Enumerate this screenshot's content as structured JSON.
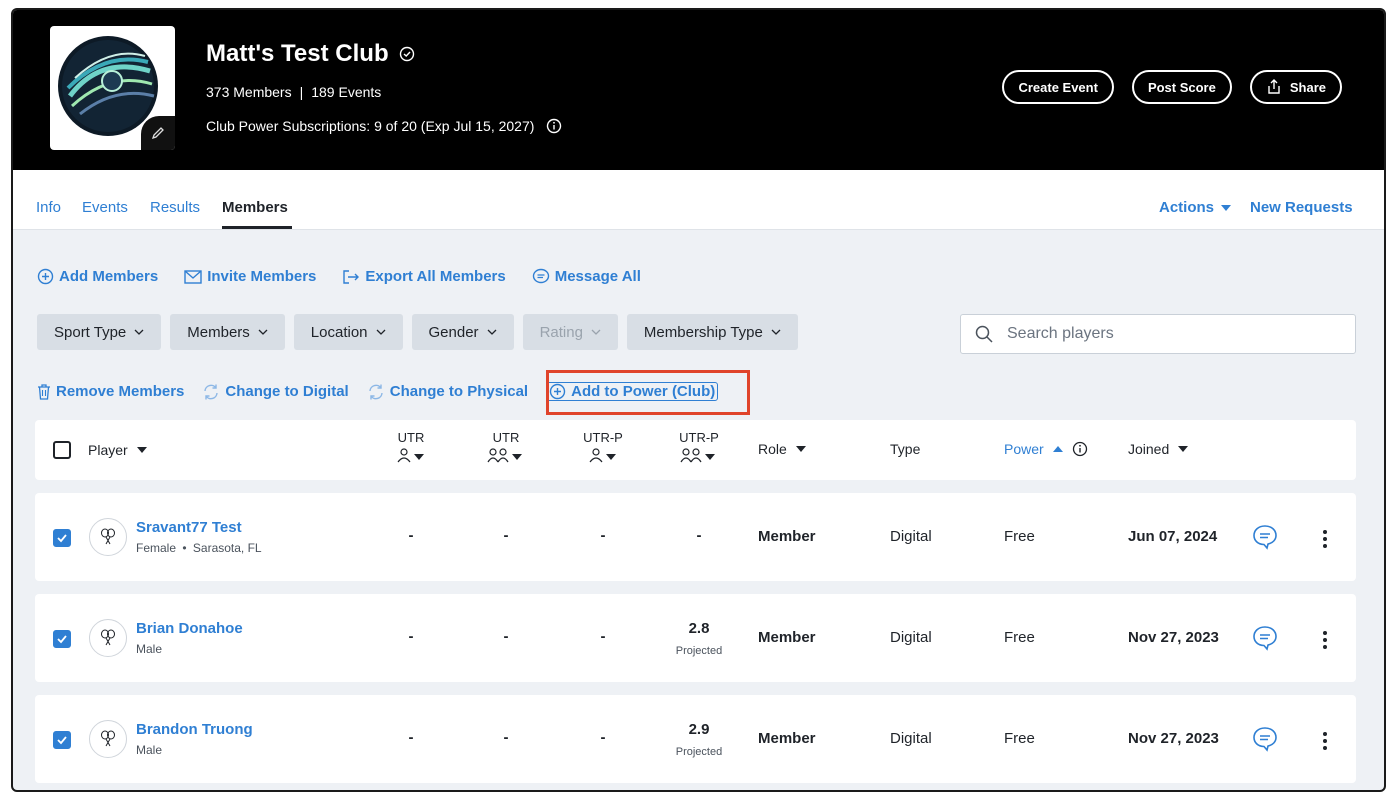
{
  "club": {
    "name": "Matt's Test Club",
    "members": "373 Members",
    "separator": "|",
    "events": "189 Events",
    "subscriptions": "Club Power Subscriptions: 9 of 20 (Exp Jul 15, 2027)"
  },
  "hero_buttons": {
    "create_event": "Create Event",
    "post_score": "Post Score",
    "share": "Share"
  },
  "tabs": [
    {
      "label": "Info"
    },
    {
      "label": "Events"
    },
    {
      "label": "Results"
    },
    {
      "label": "Members"
    }
  ],
  "tabs_right": {
    "actions": "Actions",
    "new_requests": "New Requests"
  },
  "member_actions": {
    "add": "Add Members",
    "invite": "Invite Members",
    "export": "Export All Members",
    "message": "Message All"
  },
  "filters": [
    {
      "label": "Sport Type"
    },
    {
      "label": "Members"
    },
    {
      "label": "Location"
    },
    {
      "label": "Gender"
    },
    {
      "label": "Rating"
    },
    {
      "label": "Membership Type"
    }
  ],
  "search": {
    "placeholder": "Search players",
    "value": ""
  },
  "bulk_actions": {
    "remove": "Remove Members",
    "digital": "Change to Digital",
    "physical": "Change to Physical",
    "power": "Add to Power (Club)"
  },
  "columns": {
    "player": "Player",
    "utr": "UTR",
    "utr_p": "UTR-P",
    "role": "Role",
    "type": "Type",
    "power": "Power",
    "joined": "Joined"
  },
  "rows": [
    {
      "name": "Sravant77 Test",
      "gender": "Female",
      "location": "Sarasota, FL",
      "utr_s": "-",
      "utr_d": "-",
      "utrp_s": "-",
      "utrp_d": "-",
      "projected": "",
      "role": "Member",
      "type": "Digital",
      "power": "Free",
      "joined": "Jun 07, 2024"
    },
    {
      "name": "Brian Donahoe",
      "gender": "Male",
      "location": "",
      "utr_s": "-",
      "utr_d": "-",
      "utrp_s": "-",
      "utrp_d": "2.8",
      "projected": "Projected",
      "role": "Member",
      "type": "Digital",
      "power": "Free",
      "joined": "Nov 27, 2023"
    },
    {
      "name": "Brandon Truong",
      "gender": "Male",
      "location": "",
      "utr_s": "-",
      "utr_d": "-",
      "utrp_s": "-",
      "utrp_d": "2.9",
      "projected": "Projected",
      "role": "Member",
      "type": "Digital",
      "power": "Free",
      "joined": "Nov 27, 2023"
    }
  ],
  "colors": {
    "accent": "#2f7fd3",
    "highlight": "#e0442b",
    "header_bg": "#000000"
  }
}
